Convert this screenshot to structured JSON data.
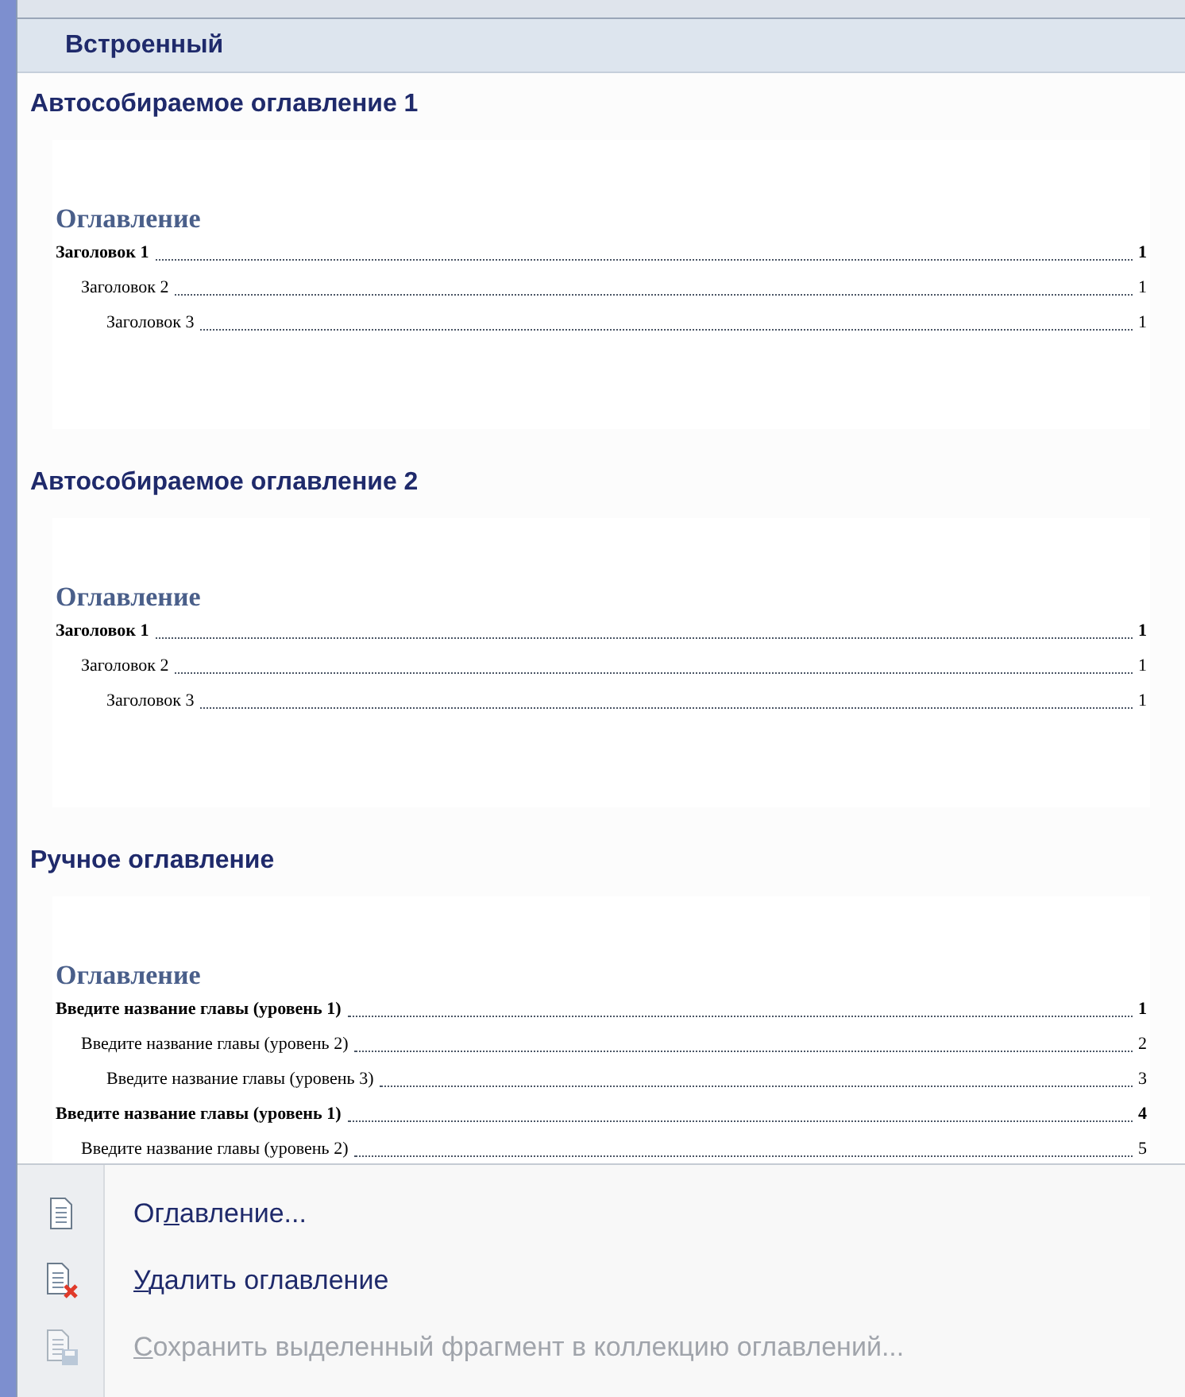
{
  "gallery": {
    "header": "Встроенный",
    "items": [
      {
        "title": "Автособираемое оглавление 1",
        "preview": {
          "heading": "Оглавление",
          "entries": [
            {
              "text": "Заголовок 1",
              "page": "1",
              "children": [
                {
                  "text": "Заголовок 2",
                  "page": "1",
                  "children": [
                    {
                      "text": "Заголовок 3",
                      "page": "1"
                    }
                  ]
                }
              ]
            }
          ]
        }
      },
      {
        "title": "Автособираемое оглавление 2",
        "preview": {
          "heading": "Оглавление",
          "entries": [
            {
              "text": "Заголовок 1",
              "page": "1",
              "children": [
                {
                  "text": "Заголовок 2",
                  "page": "1",
                  "children": [
                    {
                      "text": "Заголовок 3",
                      "page": "1"
                    }
                  ]
                }
              ]
            }
          ]
        }
      },
      {
        "title": "Ручное оглавление",
        "preview": {
          "heading": "Оглавление",
          "entries": [
            {
              "text": "Введите название главы (уровень 1)",
              "page": "1",
              "children": [
                {
                  "text": "Введите название главы (уровень 2)",
                  "page": "2",
                  "children": [
                    {
                      "text": "Введите название главы (уровень 3)",
                      "page": "3"
                    }
                  ]
                }
              ]
            },
            {
              "text": "Введите название главы (уровень 1)",
              "page": "4",
              "children": [
                {
                  "text": "Введите название главы (уровень 2)",
                  "page": "5"
                }
              ]
            }
          ]
        }
      }
    ]
  },
  "menu": [
    {
      "kind": "dialog",
      "label_before": "Ог",
      "access_key": "л",
      "label_after": "авление...",
      "disabled": false
    },
    {
      "kind": "remove",
      "access_key": "У",
      "label_after": "далить оглавление",
      "disabled": false
    },
    {
      "kind": "save",
      "access_key": "С",
      "label_after": "охранить выделенный фрагмент в коллекцию оглавлений...",
      "disabled": true
    }
  ]
}
